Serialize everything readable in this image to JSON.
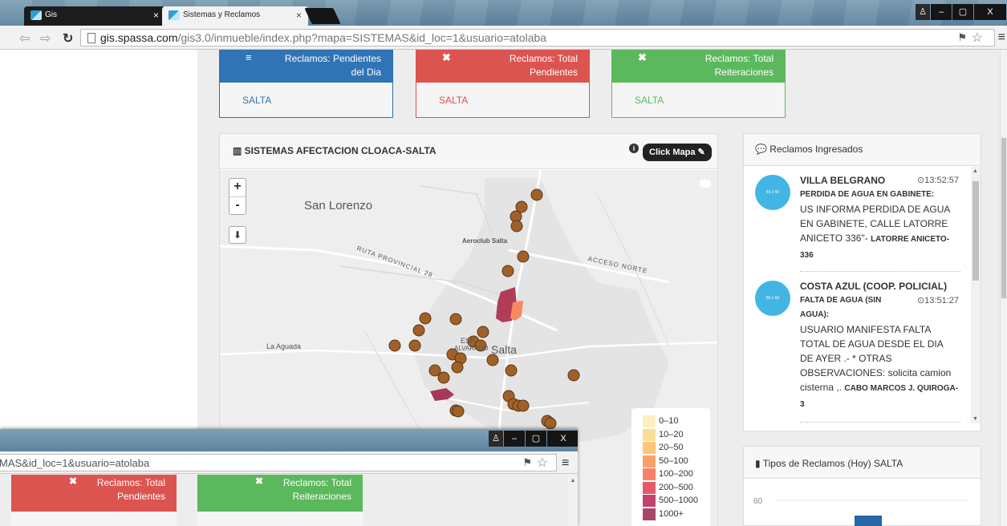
{
  "browser": {
    "tabs": [
      {
        "label": "Gis",
        "close": "×"
      },
      {
        "label": "Sistemas y Reclamos",
        "close": "×"
      }
    ],
    "url_host": "gis.spassa.com",
    "url_path": "/gis3.0/inmueble/index.php?mapa=SISTEMAS&id_loc=1&usuario=atolaba",
    "window_controls": {
      "minimize": "–",
      "maximize": "▢",
      "close": "X"
    }
  },
  "stats": [
    {
      "label": "Reclamos: Pendientes del Dia",
      "line1": "Reclamos: Pendientes",
      "line2": "del Dia",
      "footer": "SALTA",
      "icon": "≡",
      "color": "#3174b5"
    },
    {
      "label": "Reclamos: Total Pendientes",
      "line1": "Reclamos: Total",
      "line2": "Pendientes",
      "footer": "SALTA",
      "icon": "✖",
      "color": "#dc5450"
    },
    {
      "label": "Reclamos: Total Reiteraciones",
      "line1": "Reclamos: Total",
      "line2": "Reiteraciones",
      "footer": "SALTA",
      "icon": "✖",
      "color": "#5cb85c"
    }
  ],
  "map_panel": {
    "title": "SISTEMAS AFECTACION CLOACA-SALTA",
    "info_icon": "i",
    "button": "Click Mapa",
    "zoom_in": "+",
    "zoom_out": "-",
    "download_icon": "⬇",
    "labels": {
      "san_lorenzo": "San Lorenzo",
      "aeroclub": "Aeroclub Salta",
      "ruta": "RUTA PROVINCIAL 28",
      "acceso": "ACCESO NORTE",
      "la_aguada": "La Aguada",
      "salta": "Salta",
      "esp": "ESP",
      "alvarado": "ALVARADO"
    },
    "legend": [
      {
        "label": "0–10",
        "color": "#fdefc1"
      },
      {
        "label": "10–20",
        "color": "#fddc93"
      },
      {
        "label": "20–50",
        "color": "#fcc679"
      },
      {
        "label": "50–100",
        "color": "#fba066"
      },
      {
        "label": "100–200",
        "color": "#f7826a"
      },
      {
        "label": "200–500",
        "color": "#e2596a"
      },
      {
        "label": "500–1000",
        "color": "#c2426a"
      },
      {
        "label": "1000+",
        "color": "#a8466a"
      }
    ]
  },
  "feed_panel": {
    "title": "Reclamos Ingresados",
    "items": [
      {
        "location": "VILLA BELGRANO",
        "time": "13:52:57",
        "type": "PERDIDA DE AGUA EN GABINETE:",
        "text": "US INFORMA PERDIDA DE AGUA EN GABINETE, CALLE LATORRE ANICETO 336\"-",
        "address": "LATORRE ANICETO-336",
        "avatar": "50 x 50"
      },
      {
        "location": "COSTA AZUL (COOP. POLICIAL)",
        "time": "13:51:27",
        "type": "FALTA DE AGUA (SIN AGUA):",
        "text": "USUARIO MANIFESTA FALTA TOTAL DE AGUA DESDE EL DIA DE AYER .- * OTRAS OBSERVACIONES: solicita camion cisterna ,.",
        "address": "CABO MARCOS J. QUIROGA-3",
        "avatar": "50 x 50"
      }
    ]
  },
  "chart_panel": {
    "title": "Tipos de Reclamos (Hoy) SALTA",
    "y_tick": "60"
  },
  "second_window": {
    "url": "MAS&id_loc=1&usuario=atolaba",
    "stats": [
      {
        "line1": "Reclamos: Total",
        "line2": "Pendientes",
        "color": "#dc5450"
      },
      {
        "line1": "Reclamos: Total",
        "line2": "Reiteraciones",
        "color": "#5cb85c"
      }
    ]
  }
}
